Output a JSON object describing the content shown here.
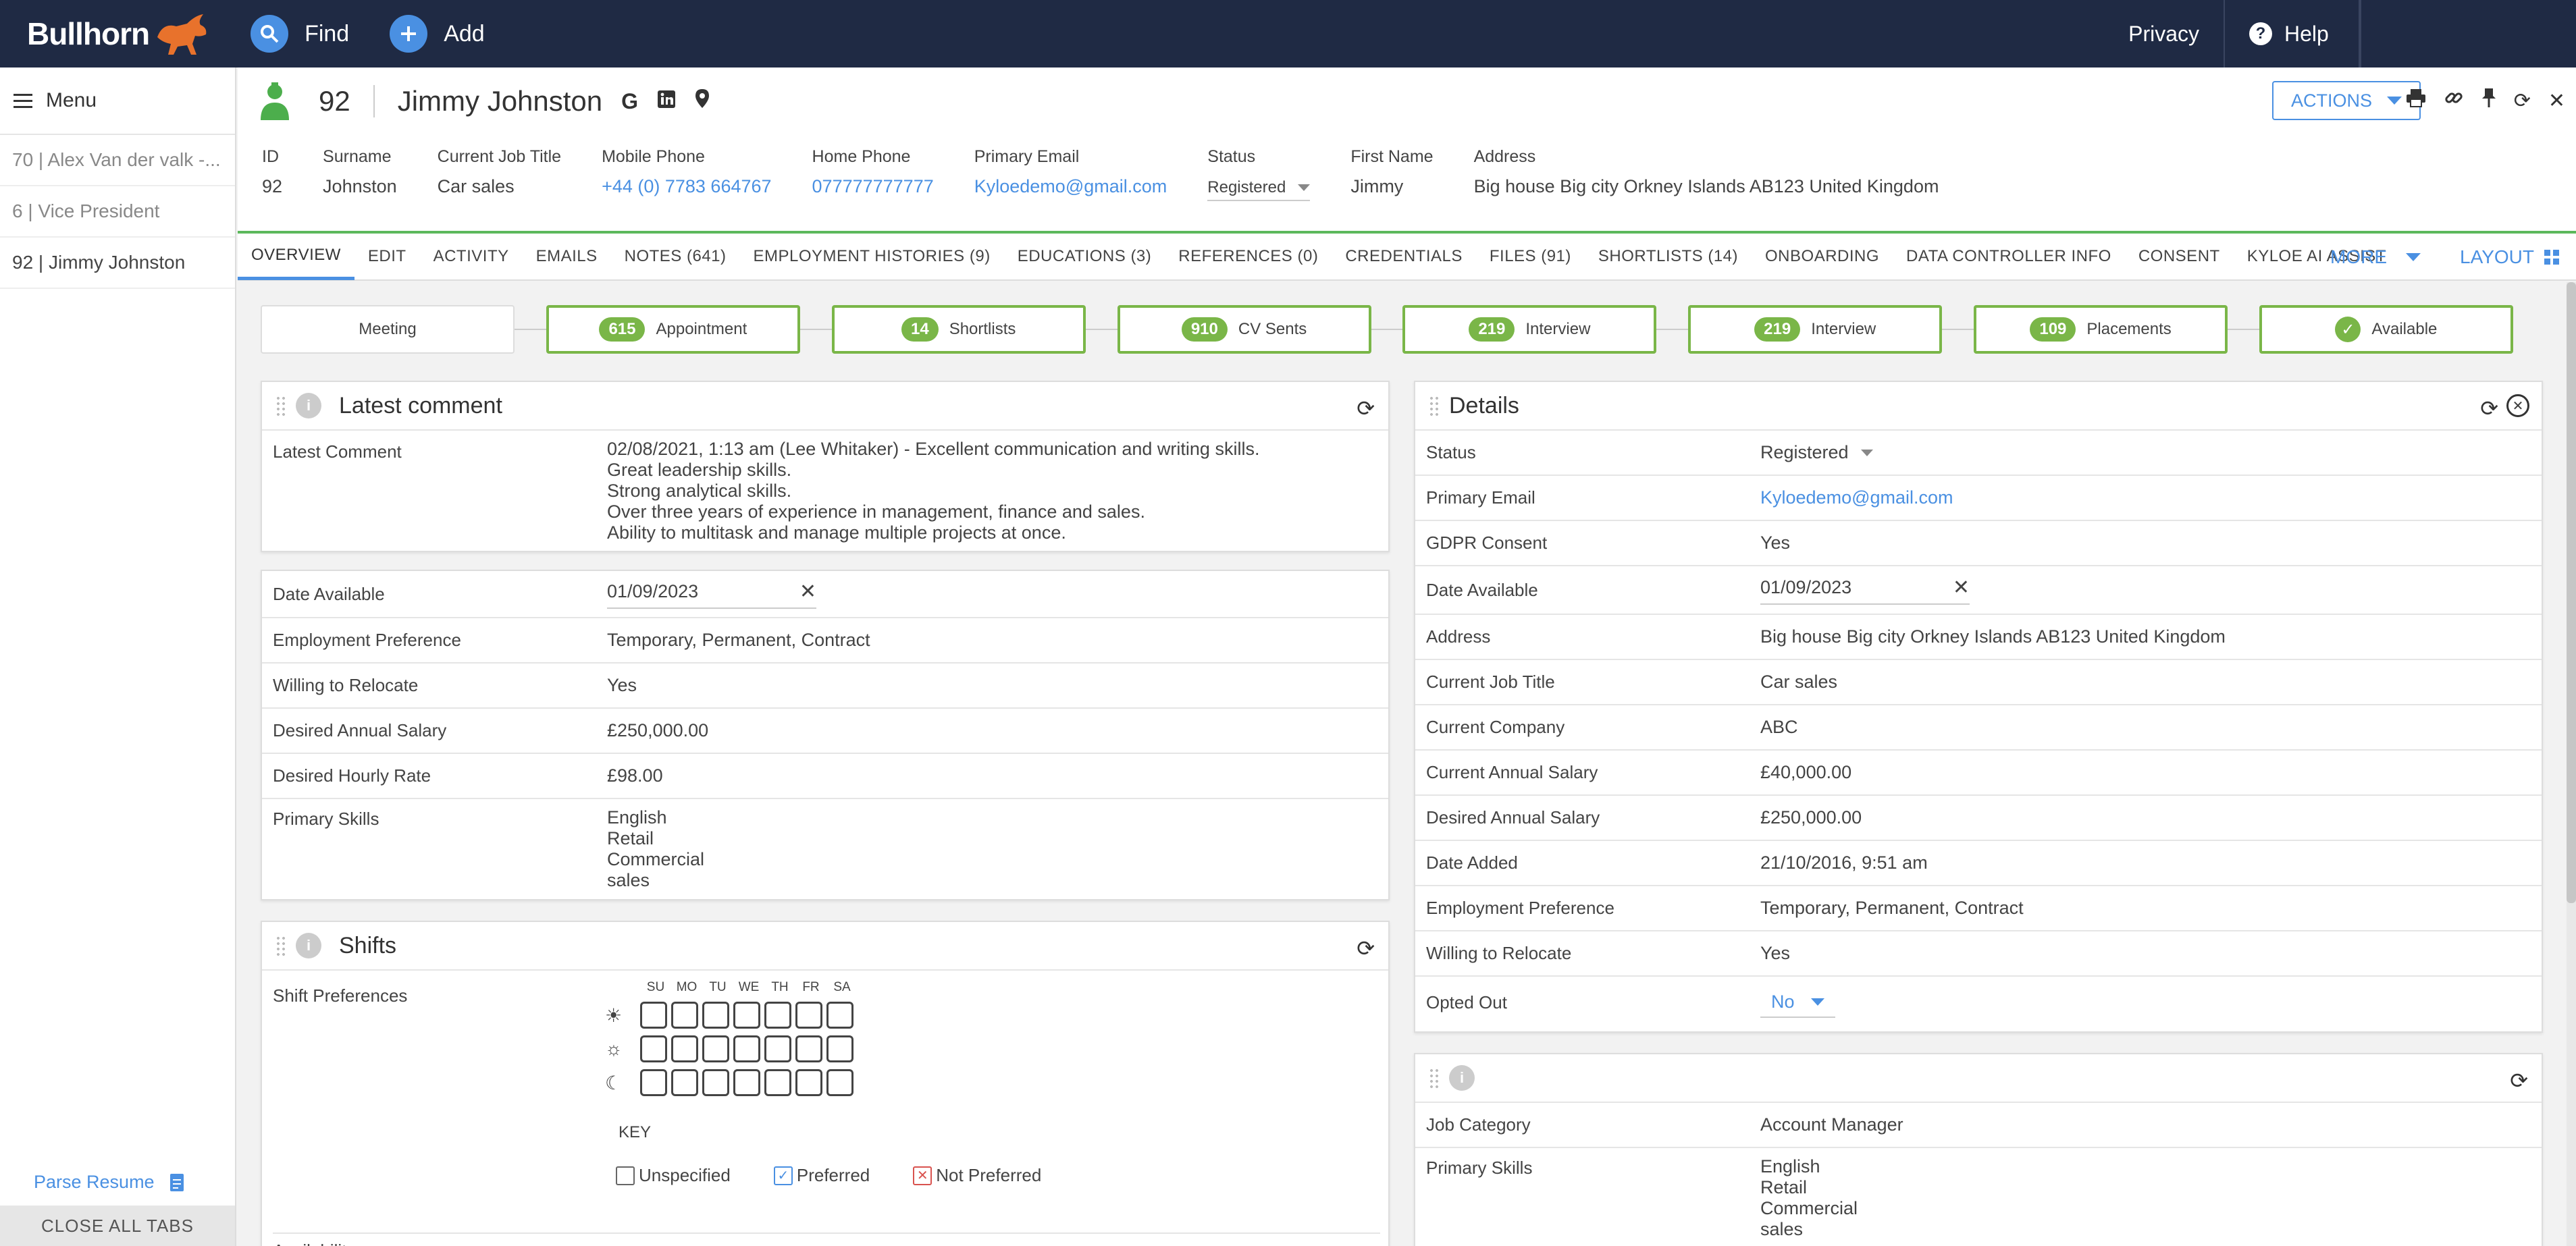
{
  "topbar": {
    "brand": "Bullhorn",
    "find": "Find",
    "add": "Add",
    "privacy": "Privacy",
    "help": "Help"
  },
  "sidebar": {
    "menu": "Menu",
    "recent": [
      "70 | Alex Van der valk -...",
      "6 | Vice President",
      "92 | Jimmy Johnston"
    ],
    "parse": "Parse Resume",
    "close_all": "CLOSE ALL TABS"
  },
  "record": {
    "id": "92",
    "name": "Jimmy Johnston",
    "actions": "ACTIONS",
    "fields": [
      {
        "label": "ID",
        "value": "92"
      },
      {
        "label": "Surname",
        "value": "Johnston"
      },
      {
        "label": "Current Job Title",
        "value": "Car sales"
      },
      {
        "label": "Mobile Phone",
        "value": "+44 (0) 7783 664767"
      },
      {
        "label": "Home Phone",
        "value": "077777777777"
      },
      {
        "label": "Primary Email",
        "value": "Kyloedemo@gmail.com"
      },
      {
        "label": "Status",
        "value": "Registered"
      },
      {
        "label": "First Name",
        "value": "Jimmy"
      },
      {
        "label": "Address",
        "value": "Big house Big city Orkney Islands AB123 United Kingdom"
      }
    ]
  },
  "tabs": [
    "OVERVIEW",
    "EDIT",
    "ACTIVITY",
    "EMAILS",
    "NOTES (641)",
    "EMPLOYMENT HISTORIES (9)",
    "EDUCATIONS (3)",
    "REFERENCES (0)",
    "CREDENTIALS",
    "FILES (91)",
    "SHORTLISTS (14)",
    "ONBOARDING",
    "DATA CONTROLLER INFO",
    "CONSENT",
    "KYLOE AI ASSIST"
  ],
  "tabs_more": "MORE",
  "tabs_layout": "LAYOUT",
  "pipeline": [
    {
      "count": "",
      "label": "Meeting"
    },
    {
      "count": "615",
      "label": "Appointment"
    },
    {
      "count": "14",
      "label": "Shortlists"
    },
    {
      "count": "910",
      "label": "CV Sents"
    },
    {
      "count": "219",
      "label": "Interview"
    },
    {
      "count": "219",
      "label": "Interview"
    },
    {
      "count": "109",
      "label": "Placements"
    },
    {
      "count": "",
      "label": "Available"
    }
  ],
  "latest": {
    "title": "Latest comment",
    "label": "Latest Comment",
    "lines": [
      "02/08/2021, 1:13 am (Lee Whitaker) - Excellent communication and writing skills.",
      "Great leadership skills.",
      "Strong analytical skills.",
      "Over three years of experience in management, finance and sales.",
      "Ability to multitask and manage multiple projects at once."
    ]
  },
  "avail": {
    "date_label": "Date Available",
    "date_value": "01/09/2023",
    "rows": [
      {
        "label": "Employment Preference",
        "value": "Temporary, Permanent, Contract"
      },
      {
        "label": "Willing to Relocate",
        "value": "Yes"
      },
      {
        "label": "Desired Annual Salary",
        "value": "£250,000.00"
      },
      {
        "label": "Desired Hourly Rate",
        "value": "£98.00"
      }
    ],
    "skills_label": "Primary Skills",
    "skills": [
      "English",
      "Retail",
      "Commercial",
      "sales"
    ]
  },
  "shifts": {
    "title": "Shifts",
    "label": "Shift Preferences",
    "days": [
      "SU",
      "MO",
      "TU",
      "WE",
      "TH",
      "FR",
      "SA"
    ],
    "key": "KEY",
    "unspecified": "Unspecified",
    "preferred": "Preferred",
    "not_preferred": "Not Preferred",
    "availability": "Availability"
  },
  "details": {
    "title": "Details",
    "status_label": "Status",
    "status_value": "Registered",
    "email_label": "Primary Email",
    "email_value": "Kyloedemo@gmail.com",
    "gdpr_label": "GDPR Consent",
    "gdpr_value": "Yes",
    "date_label": "Date Available",
    "date_value": "01/09/2023",
    "rows": [
      {
        "label": "Address",
        "value": "Big house Big city Orkney Islands AB123 United Kingdom"
      },
      {
        "label": "Current Job Title",
        "value": "Car sales"
      },
      {
        "label": "Current Company",
        "value": "ABC"
      },
      {
        "label": "Current Annual Salary",
        "value": "£40,000.00"
      },
      {
        "label": "Desired Annual Salary",
        "value": "£250,000.00"
      },
      {
        "label": "Date Added",
        "value": "21/10/2016, 9:51 am"
      },
      {
        "label": "Employment Preference",
        "value": "Temporary, Permanent, Contract"
      },
      {
        "label": "Willing to Relocate",
        "value": "Yes"
      }
    ],
    "opted_label": "Opted Out",
    "opted_value": "No"
  },
  "third": {
    "job_label": "Job Category",
    "job_value": "Account Manager",
    "skills_label": "Primary Skills",
    "skills": [
      "English",
      "Retail",
      "Commercial",
      "sales"
    ]
  },
  "colors": {
    "navy": "#1f2a44",
    "accent": "#4a90e2",
    "green": "#7ab648",
    "brand_orange": "#e8722c"
  }
}
